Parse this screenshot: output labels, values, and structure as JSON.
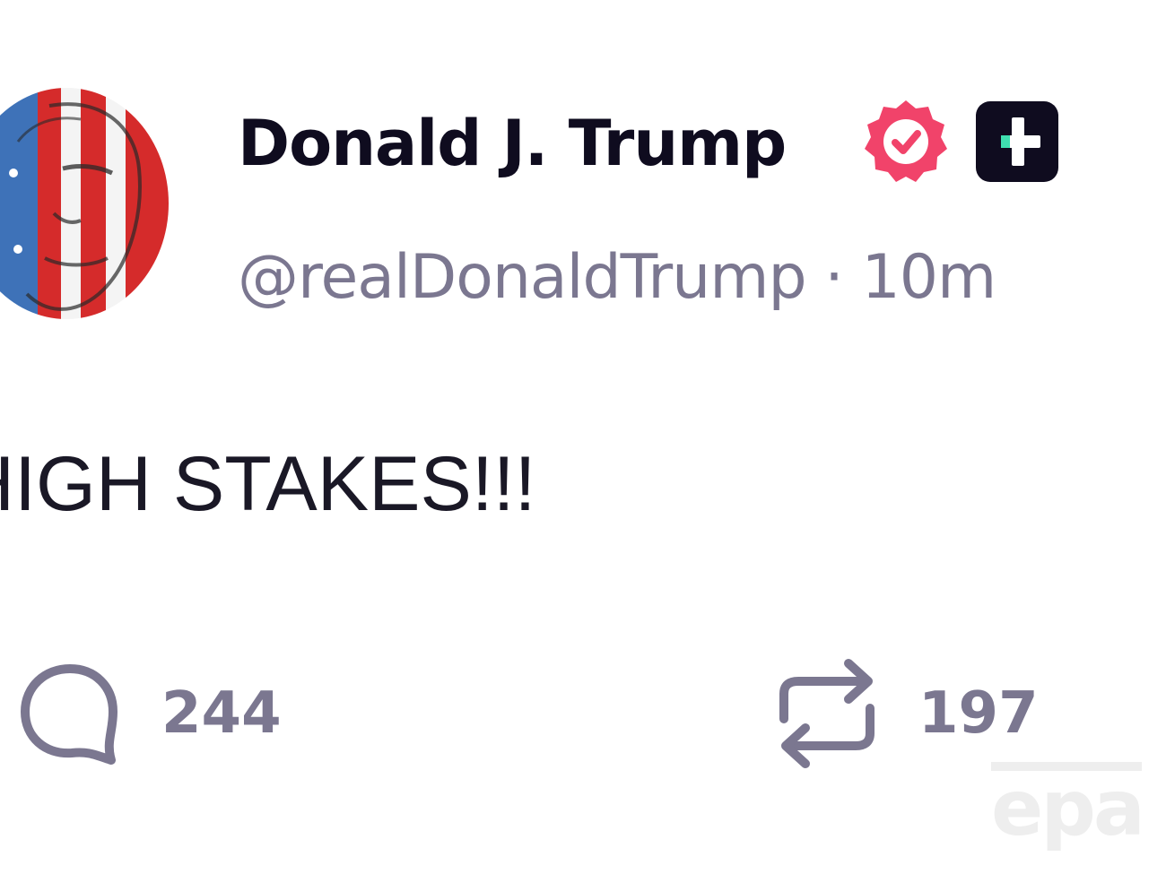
{
  "post": {
    "author": {
      "display_name": "Donald J. Trump",
      "handle": "@realDonaldTrump",
      "separator": "·",
      "time": "10m",
      "avatar_icon": "flag-portrait-avatar",
      "verified_icon": "verified-badge-icon",
      "verified_color": "#f1436a",
      "plus_icon": "plus-badge-icon"
    },
    "text": "HIGH STAKES!!!",
    "actions": {
      "reply": {
        "icon": "reply-icon",
        "count": "244"
      },
      "repost": {
        "icon": "repost-icon",
        "count": "197"
      }
    }
  },
  "watermark": {
    "text": "epa"
  }
}
